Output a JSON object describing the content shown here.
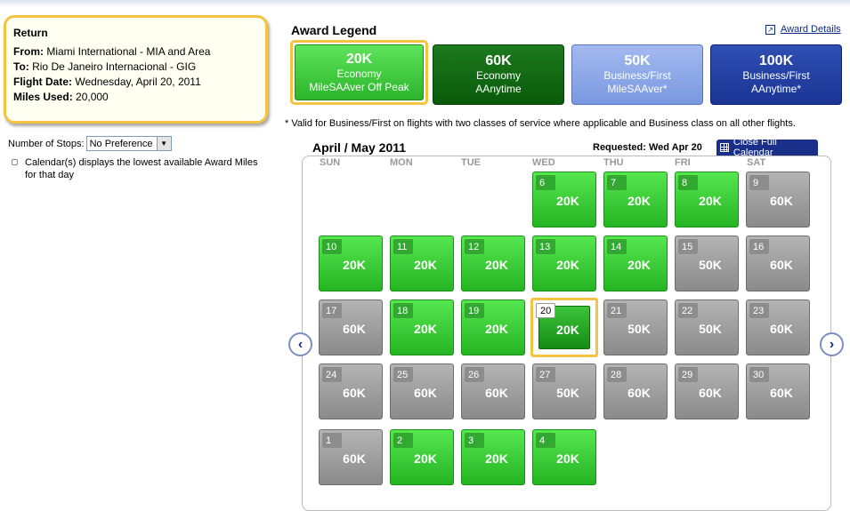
{
  "return_box": {
    "title": "Return",
    "from_label": "From:",
    "from_value": " Miami International - MIA and Area",
    "to_label": "To:",
    "to_value": " Rio De Janeiro Internacional - GIG",
    "date_label": "Flight Date:",
    "date_value": " Wednesday, April 20, 2011",
    "miles_label": "Miles Used:",
    "miles_value": " 20,000"
  },
  "stops": {
    "label": "Number of Stops:",
    "value": "No Preference"
  },
  "note": "Calendar(s) displays the lowest available Award Miles for that day",
  "legend": {
    "title": "Award Legend",
    "details_link": "Award Details",
    "items": [
      {
        "value": "20K",
        "line1": "Economy",
        "line2": "MileSAAver Off Peak"
      },
      {
        "value": "60K",
        "line1": "Economy",
        "line2": "AAnytime"
      },
      {
        "value": "50K",
        "line1": "Business/First",
        "line2": "MileSAAver*"
      },
      {
        "value": "100K",
        "line1": "Business/First",
        "line2": "AAnytime*"
      }
    ],
    "footnote": "* Valid for Business/First on flights with two classes of service where applicable and Business class on all other flights."
  },
  "calendar": {
    "month_label": "April / May 2011",
    "requested": "Requested: Wed Apr 20",
    "close_label": "Close Full Calendar",
    "weekdays": [
      "SUN",
      "MON",
      "TUE",
      "WED",
      "THU",
      "FRI",
      "SAT"
    ],
    "days": [
      {
        "day": "6",
        "miles": "20K",
        "type": "green"
      },
      {
        "day": "7",
        "miles": "20K",
        "type": "green"
      },
      {
        "day": "8",
        "miles": "20K",
        "type": "green"
      },
      {
        "day": "9",
        "miles": "60K",
        "type": "gray"
      },
      {
        "day": "10",
        "miles": "20K",
        "type": "green"
      },
      {
        "day": "11",
        "miles": "20K",
        "type": "green"
      },
      {
        "day": "12",
        "miles": "20K",
        "type": "green"
      },
      {
        "day": "13",
        "miles": "20K",
        "type": "green"
      },
      {
        "day": "14",
        "miles": "20K",
        "type": "green"
      },
      {
        "day": "15",
        "miles": "50K",
        "type": "gray"
      },
      {
        "day": "16",
        "miles": "60K",
        "type": "gray"
      },
      {
        "day": "17",
        "miles": "60K",
        "type": "gray"
      },
      {
        "day": "18",
        "miles": "20K",
        "type": "green"
      },
      {
        "day": "19",
        "miles": "20K",
        "type": "green"
      },
      {
        "day": "20",
        "miles": "20K",
        "type": "selected"
      },
      {
        "day": "21",
        "miles": "50K",
        "type": "gray"
      },
      {
        "day": "22",
        "miles": "50K",
        "type": "gray"
      },
      {
        "day": "23",
        "miles": "60K",
        "type": "gray"
      },
      {
        "day": "24",
        "miles": "60K",
        "type": "gray"
      },
      {
        "day": "25",
        "miles": "60K",
        "type": "gray"
      },
      {
        "day": "26",
        "miles": "60K",
        "type": "gray"
      },
      {
        "day": "27",
        "miles": "50K",
        "type": "gray"
      },
      {
        "day": "28",
        "miles": "60K",
        "type": "gray"
      },
      {
        "day": "29",
        "miles": "60K",
        "type": "gray"
      },
      {
        "day": "30",
        "miles": "60K",
        "type": "gray"
      },
      {
        "day": "1",
        "miles": "60K",
        "type": "gray"
      },
      {
        "day": "2",
        "miles": "20K",
        "type": "green"
      },
      {
        "day": "3",
        "miles": "20K",
        "type": "green"
      },
      {
        "day": "4",
        "miles": "20K",
        "type": "green"
      }
    ]
  },
  "colors": {
    "green": "#2bb52a",
    "gray": "#9a9a9a",
    "highlight": "#f5c342",
    "navy": "#1a2f8a"
  }
}
